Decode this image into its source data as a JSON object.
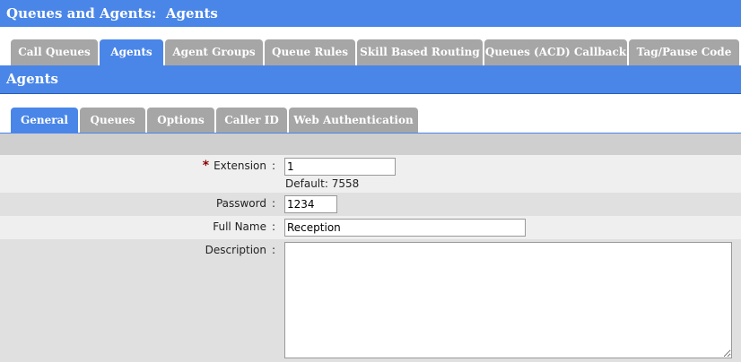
{
  "header": {
    "title": "Queues and Agents:  Agents"
  },
  "main_tabs": [
    {
      "label": "Call Queues"
    },
    {
      "label": "Agents"
    },
    {
      "label": "Agent Groups"
    },
    {
      "label": "Queue Rules"
    },
    {
      "label": "Skill Based Routing"
    },
    {
      "label": "Queues (ACD) Callback"
    },
    {
      "label": "Tag/Pause Code"
    }
  ],
  "active_main_tab": "Agents",
  "section": {
    "title": "Agents"
  },
  "sub_tabs": [
    {
      "label": "General"
    },
    {
      "label": "Queues"
    },
    {
      "label": "Options"
    },
    {
      "label": "Caller ID"
    },
    {
      "label": "Web Authentication"
    }
  ],
  "active_sub_tab": "General",
  "form": {
    "extension": {
      "required_mark": "*",
      "label": "Extension",
      "colon": ":",
      "value": "1",
      "hint": "Default: 7558"
    },
    "password": {
      "label": "Password",
      "colon": ":",
      "value": "1234"
    },
    "full_name": {
      "label": "Full Name",
      "colon": ":",
      "value": "Reception"
    },
    "description": {
      "label": "Description",
      "colon": ":",
      "value": ""
    }
  },
  "colors": {
    "accent": "#4a86e8",
    "inactive_tab": "#a6a6a6",
    "required": "#8b0000"
  }
}
